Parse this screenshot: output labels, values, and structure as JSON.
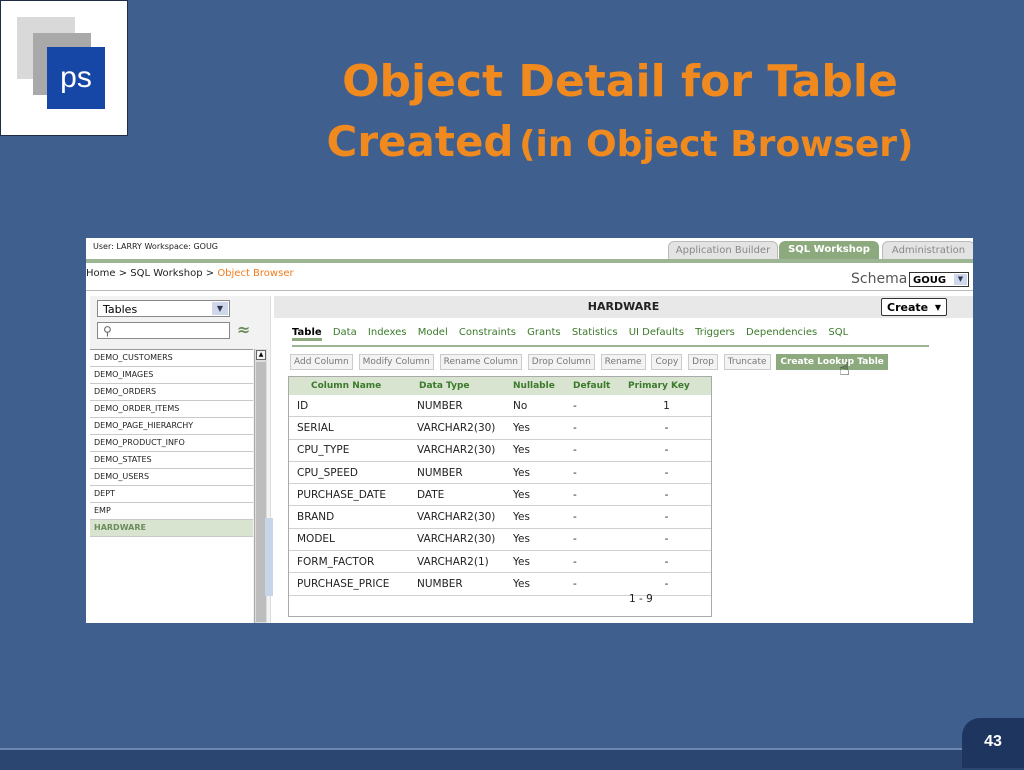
{
  "slide": {
    "title_line1": "Object Detail for Table",
    "title_line2_main": "Created",
    "title_line2_sub": "(in Object Browser)",
    "page_number": "43",
    "logo_text": "ps"
  },
  "app": {
    "user_info": "User: LARRY   Workspace: GOUG",
    "tabs": [
      "Application Builder",
      "SQL Workshop",
      "Administration"
    ],
    "active_tab": "SQL Workshop",
    "breadcrumb_prefix": "Home > SQL Workshop > ",
    "breadcrumb_current": "Object Browser",
    "schema_label": "Schema",
    "schema_value": "GOUG"
  },
  "left_panel": {
    "object_type": "Tables",
    "search_value": "",
    "objects": [
      "DEMO_CUSTOMERS",
      "DEMO_IMAGES",
      "DEMO_ORDERS",
      "DEMO_ORDER_ITEMS",
      "DEMO_PAGE_HIERARCHY",
      "DEMO_PRODUCT_INFO",
      "DEMO_STATES",
      "DEMO_USERS",
      "DEPT",
      "EMP",
      "HARDWARE"
    ],
    "selected": "HARDWARE"
  },
  "detail": {
    "table_name": "HARDWARE",
    "create_label": "Create",
    "subtabs": [
      "Table",
      "Data",
      "Indexes",
      "Model",
      "Constraints",
      "Grants",
      "Statistics",
      "UI Defaults",
      "Triggers",
      "Dependencies",
      "SQL"
    ],
    "active_subtab": "Table",
    "actions": [
      "Add Column",
      "Modify Column",
      "Rename Column",
      "Drop Column",
      "Rename",
      "Copy",
      "Drop",
      "Truncate",
      "Create Lookup Table"
    ],
    "active_action": "Create Lookup Table",
    "columns_header": [
      "Column Name",
      "Data Type",
      "Nullable",
      "Default",
      "Primary Key"
    ],
    "rows": [
      [
        "ID",
        "NUMBER",
        "No",
        "-",
        "1"
      ],
      [
        "SERIAL",
        "VARCHAR2(30)",
        "Yes",
        "-",
        "-"
      ],
      [
        "CPU_TYPE",
        "VARCHAR2(30)",
        "Yes",
        "-",
        "-"
      ],
      [
        "CPU_SPEED",
        "NUMBER",
        "Yes",
        "-",
        "-"
      ],
      [
        "PURCHASE_DATE",
        "DATE",
        "Yes",
        "-",
        "-"
      ],
      [
        "BRAND",
        "VARCHAR2(30)",
        "Yes",
        "-",
        "-"
      ],
      [
        "MODEL",
        "VARCHAR2(30)",
        "Yes",
        "-",
        "-"
      ],
      [
        "FORM_FACTOR",
        "VARCHAR2(1)",
        "Yes",
        "-",
        "-"
      ],
      [
        "PURCHASE_PRICE",
        "NUMBER",
        "Yes",
        "-",
        "-"
      ]
    ],
    "pager": "1 - 9"
  },
  "colors": {
    "background": "#3f5f8f",
    "title": "#f08a1e",
    "accent_green": "#8caa7e",
    "link_green": "#3a7a2a"
  }
}
